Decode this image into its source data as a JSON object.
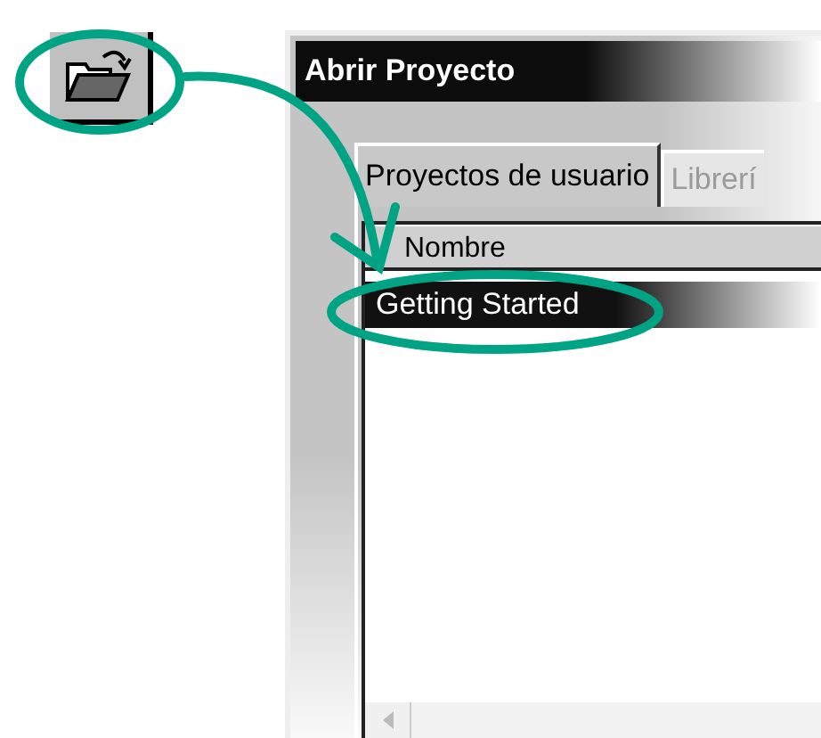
{
  "window": {
    "title": "Abrir Proyecto"
  },
  "tabs": [
    {
      "label": "Proyectos de usuario",
      "selected": true
    },
    {
      "label": "Librerí",
      "selected": false
    }
  ],
  "list": {
    "columns": [
      "Nombre"
    ],
    "rows": [
      {
        "name": "Getting Started",
        "selected": true
      }
    ]
  }
}
